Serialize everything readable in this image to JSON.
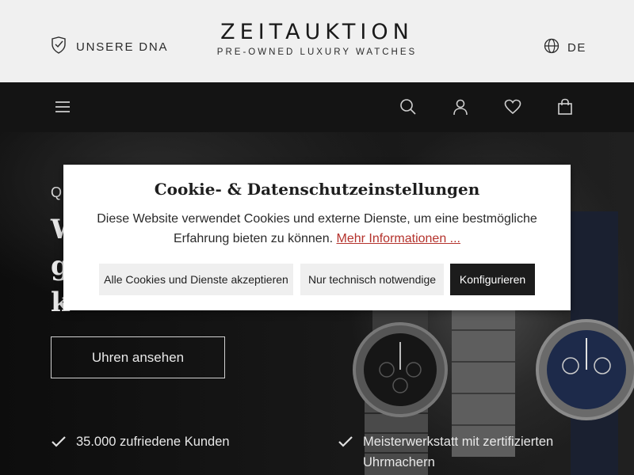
{
  "header": {
    "dna_label": "UNSERE DNA",
    "logo_title": "ZEITAUKTION",
    "logo_subtitle": "PRE-OWNED LUXURY WATCHES",
    "language": "DE"
  },
  "nav": {
    "icons": [
      "menu-icon",
      "search-icon",
      "user-icon",
      "heart-icon",
      "shopping-bag-icon"
    ]
  },
  "hero": {
    "kicker": "Q",
    "headline": "W\ng\nk",
    "cta_label": "Uhren ansehen",
    "usps": [
      {
        "text": "35.000 zufriedene Kunden"
      },
      {
        "text": "Meisterwerkstatt mit zertifizierten Uhrmachern"
      }
    ]
  },
  "cookie": {
    "title": "Cookie- & Datenschutzeinstellungen",
    "text": "Diese Website verwendet Cookies und externe Dienste, um eine bestmögliche Erfahrung bieten zu können.",
    "link": "Mehr Informationen ...",
    "buttons": {
      "accept_all": "Alle Cookies und Dienste akzeptieren",
      "necessary": "Nur technisch notwendige",
      "configure": "Konfigurieren"
    }
  },
  "colors": {
    "header_bg": "#f0f0f0",
    "nav_bg": "#141414",
    "link": "#b4322c",
    "dark_button": "#1c1c1c"
  }
}
